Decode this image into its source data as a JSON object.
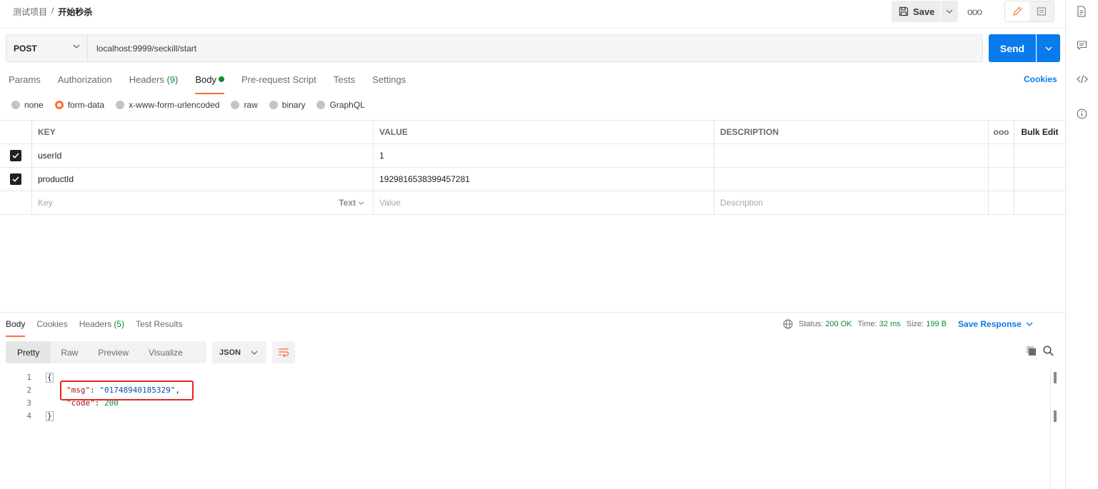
{
  "breadcrumb": {
    "project": "测试项目",
    "separator": "/",
    "request": "开始秒杀"
  },
  "toolbar": {
    "save_label": "Save",
    "more": "ooo"
  },
  "request": {
    "method": "POST",
    "url": "localhost:9999/seckill/start",
    "send_label": "Send"
  },
  "req_tabs": [
    {
      "label": "Params"
    },
    {
      "label": "Authorization"
    },
    {
      "label": "Headers",
      "count": "(9)"
    },
    {
      "label": "Body"
    },
    {
      "label": "Pre-request Script"
    },
    {
      "label": "Tests"
    },
    {
      "label": "Settings"
    }
  ],
  "cookies_label": "Cookies",
  "body_types": [
    {
      "label": "none",
      "selected": false
    },
    {
      "label": "form-data",
      "selected": true
    },
    {
      "label": "x-www-form-urlencoded",
      "selected": false
    },
    {
      "label": "raw",
      "selected": false
    },
    {
      "label": "binary",
      "selected": false
    },
    {
      "label": "GraphQL",
      "selected": false
    }
  ],
  "table": {
    "headers": {
      "key": "KEY",
      "value": "VALUE",
      "description": "DESCRIPTION",
      "more": "ooo",
      "bulk_edit": "Bulk Edit"
    },
    "rows": [
      {
        "key": "userId",
        "value": "1",
        "description": ""
      },
      {
        "key": "productId",
        "value": "1929816538399457281",
        "description": ""
      }
    ],
    "placeholder": {
      "key": "Key",
      "type": "Text",
      "value": "Value",
      "description": "Description"
    }
  },
  "response": {
    "tabs": [
      {
        "label": "Body"
      },
      {
        "label": "Cookies"
      },
      {
        "label": "Headers",
        "count": "(5)"
      },
      {
        "label": "Test Results"
      }
    ],
    "status_label": "Status:",
    "status": "200 OK",
    "time_label": "Time:",
    "time": "32 ms",
    "size_label": "Size:",
    "size": "199 B",
    "save_response": "Save Response",
    "views": [
      "Pretty",
      "Raw",
      "Preview",
      "Visualize"
    ],
    "format": "JSON",
    "code": {
      "line_numbers": [
        "1",
        "2",
        "3",
        "4"
      ],
      "open": "{",
      "msg_key": "\"msg\"",
      "msg_value": "\"01748940185329\"",
      "code_key": "\"code\"",
      "code_value": "200",
      "close": "}"
    }
  },
  "colors": {
    "accent": "#ff6c37",
    "primary": "#097bed",
    "success": "#0c8a2e",
    "highlight": "#e8221b"
  }
}
